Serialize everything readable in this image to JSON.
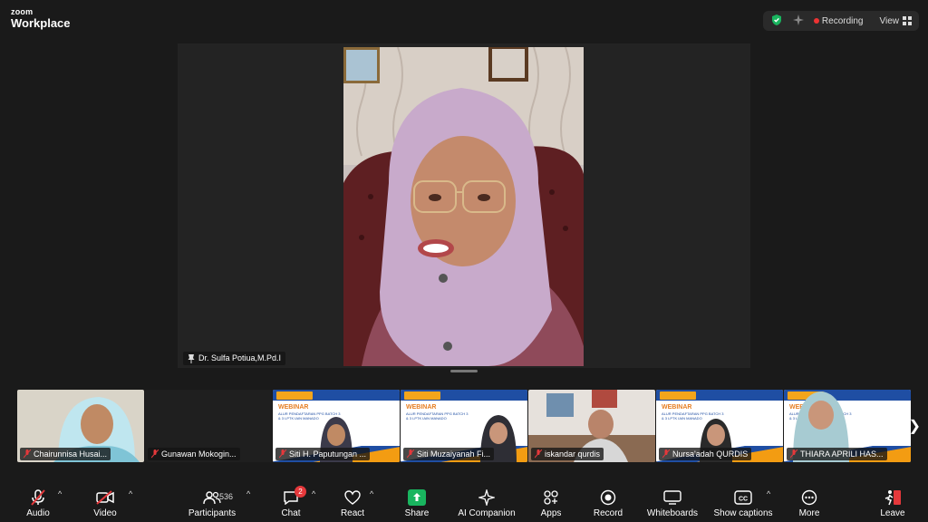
{
  "brand": {
    "small": "zoom",
    "big": "Workplace"
  },
  "top": {
    "recording_label": "Recording",
    "view_label": "View"
  },
  "speaker": {
    "name": "Dr. Sulfa Potiua,M.Pd.I"
  },
  "participants": [
    {
      "name": "Chairunnisa Husai...",
      "kind": "video"
    },
    {
      "name": "Gunawan Mokogin...",
      "kind": "blank"
    },
    {
      "name": "Siti H. Paputungan ...",
      "kind": "slide"
    },
    {
      "name": "Siti Muzaiyanah Fi...",
      "kind": "slide"
    },
    {
      "name": "iskandar qurdis",
      "kind": "video"
    },
    {
      "name": "Nursa'adah QURDIS",
      "kind": "slide"
    },
    {
      "name": "THIARA APRILI HAS...",
      "kind": "slide"
    }
  ],
  "slide": {
    "title": "WEBINAR",
    "subtitle": "ALUR PENDAFTARAN PPG BATCH 3 & 3 LPTK IAIN MANADO"
  },
  "toolbar": {
    "audio": "Audio",
    "video": "Video",
    "participants": "Participants",
    "participants_count": "536",
    "chat": "Chat",
    "chat_badge": "2",
    "react": "React",
    "share": "Share",
    "ai_companion": "AI Companion",
    "apps": "Apps",
    "record": "Record",
    "whiteboards": "Whiteboards",
    "show_captions": "Show captions",
    "more": "More",
    "leave": "Leave"
  },
  "colors": {
    "accent_green": "#19b55f",
    "leave_red": "#e5383b",
    "slide_blue": "#1f4ea3",
    "slide_orange": "#f39c12"
  }
}
